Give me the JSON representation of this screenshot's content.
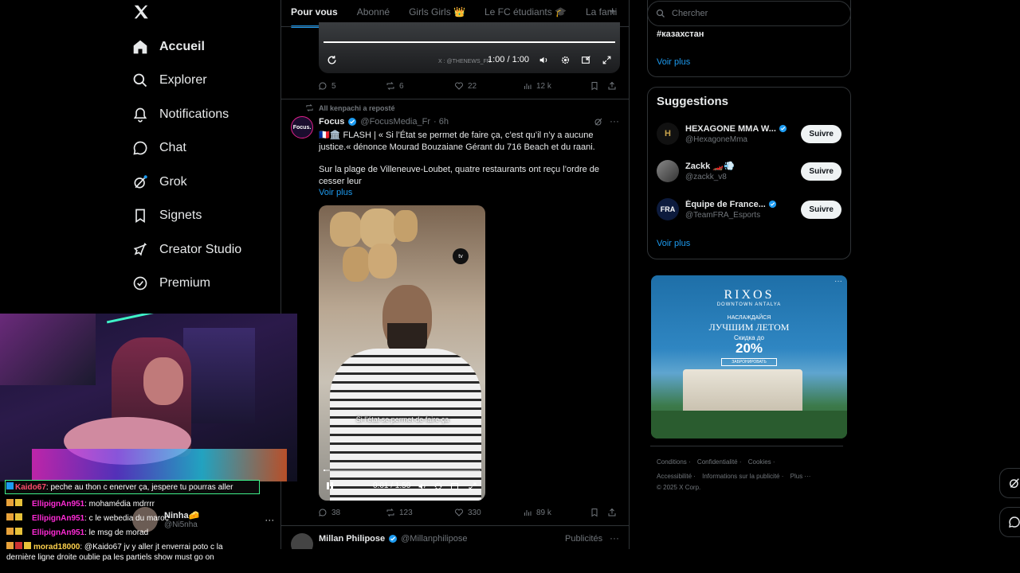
{
  "nav": {
    "items": [
      {
        "label": "Accueil",
        "icon": "home-icon"
      },
      {
        "label": "Explorer",
        "icon": "search-icon"
      },
      {
        "label": "Notifications",
        "icon": "bell-icon"
      },
      {
        "label": "Chat",
        "icon": "chat-icon"
      },
      {
        "label": "Grok",
        "icon": "grok-icon"
      },
      {
        "label": "Signets",
        "icon": "bookmark-icon"
      },
      {
        "label": "Creator Studio",
        "icon": "rocket-icon"
      },
      {
        "label": "Premium",
        "icon": "verified-icon"
      }
    ],
    "account": {
      "name": "Ninha🧀",
      "handle": "@Ni5nha"
    }
  },
  "tabs": [
    "Pour vous",
    "Abonné",
    "Girls Girls 👑",
    "Le FC étudiants 🎓",
    "La fami"
  ],
  "video1": {
    "time": "1:00 / 1:00",
    "watermark": "X : @THENEWS_FR",
    "progress": 1.0
  },
  "tweet1_actions": {
    "replies": "5",
    "reposts": "6",
    "likes": "22",
    "views": "12 k"
  },
  "tweet2": {
    "repost_note": "All kenpachi a reposté",
    "author": "Focus",
    "avatar_text": "Focus.",
    "handle": "@FocusMedia_Fr",
    "time": "· 6h",
    "text1": "🇫🇷🏛️ FLASH | « Si l’État se permet de faire ça, c’est qu’il n’y a aucune justice.« dénonce Mourad Bouzaiane Gérant du 716 Beach et du raani.",
    "text2": "Sur la plage de Villeneuve-Loubet, quatre restaurants ont reçu l’ordre de cesser leur",
    "more": "Voir plus",
    "video_time": "0:01 / 1:50",
    "video_badge": "tv",
    "subtitle": "Si l’état se permet de faire ça",
    "progress": 0.01,
    "actions": {
      "replies": "38",
      "reposts": "123",
      "likes": "330",
      "views": "89 k"
    }
  },
  "tweet3": {
    "author": "Millan Philipose",
    "handle": "@Millanphilipose",
    "label": "Publicités"
  },
  "search_placeholder": "Chercher",
  "trend": {
    "tag": "#казахстан",
    "more": "Voir plus"
  },
  "suggestions": {
    "title": "Suggestions",
    "items": [
      {
        "name": "HEXAGONE MMA W...",
        "handle": "@HexagoneMma",
        "button": "Suivre",
        "avatar": "H"
      },
      {
        "name": "Zackk 🏎️💨",
        "handle": "@zackk_v8",
        "button": "Suivre",
        "avatar": ""
      },
      {
        "name": "Équipe de France...",
        "handle": "@TeamFRA_Esports",
        "button": "Suivre",
        "avatar": "FRA"
      }
    ],
    "more": "Voir plus"
  },
  "ad": {
    "brand": "RIXOS",
    "sub": "DOWNTOWN ANTALYA",
    "line1": "НАСЛАЖДАЙСЯ",
    "line2": "ЛУЧШИМ ЛЕТОМ",
    "line3": "Скидка до",
    "pct": "20%",
    "cta": "ЗАБРОНИРОВАТЬ"
  },
  "footer": {
    "row1": [
      "Conditions",
      "Confidentialité",
      "Cookies"
    ],
    "row2": [
      "Accessibilité",
      "Informations sur la publicité",
      "Plus ···"
    ],
    "copy": "© 2025 X Corp."
  },
  "chat": [
    {
      "user": "Kaido67",
      "msg": ": peche au thon c enerver ça, jespere tu pourras aller",
      "color": "#ff4d6d"
    },
    {
      "user": "EllipignAn951",
      "msg": ": mohamédia mdrrrr",
      "color": "#ff2bd6"
    },
    {
      "user": "EllipignAn951",
      "msg": ": c le webedia du maroc",
      "color": "#ff2bd6"
    },
    {
      "user": "EllipignAn951",
      "msg": ": le msg de morad",
      "color": "#ff2bd6"
    },
    {
      "user": "morad18000",
      "msg": ": @Kaido67 jv y aller jt enverrai poto c la",
      "color": "#ffd24d"
    },
    {
      "user": "",
      "msg": "dernière ligne droite oublie pa les partiels show must go on",
      "color": "#fff"
    }
  ]
}
